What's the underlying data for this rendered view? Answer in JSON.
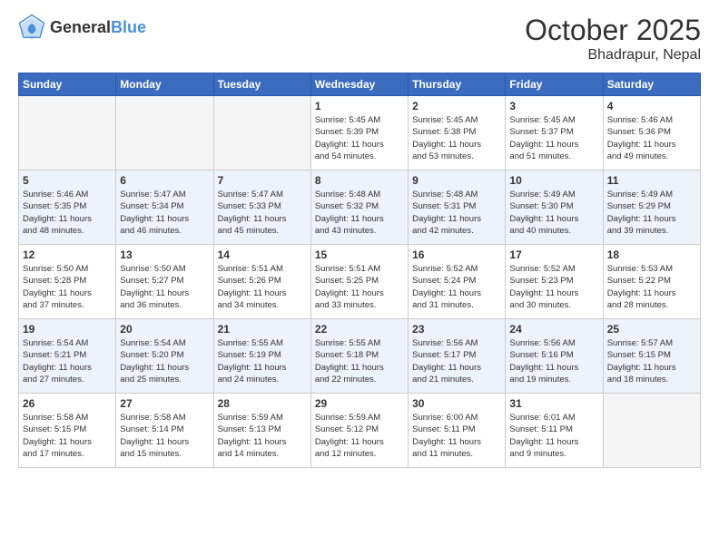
{
  "header": {
    "logo_general": "General",
    "logo_blue": "Blue",
    "month": "October 2025",
    "location": "Bhadrapur, Nepal"
  },
  "weekdays": [
    "Sunday",
    "Monday",
    "Tuesday",
    "Wednesday",
    "Thursday",
    "Friday",
    "Saturday"
  ],
  "weeks": [
    [
      {
        "day": "",
        "info": ""
      },
      {
        "day": "",
        "info": ""
      },
      {
        "day": "",
        "info": ""
      },
      {
        "day": "1",
        "info": "Sunrise: 5:45 AM\nSunset: 5:39 PM\nDaylight: 11 hours\nand 54 minutes."
      },
      {
        "day": "2",
        "info": "Sunrise: 5:45 AM\nSunset: 5:38 PM\nDaylight: 11 hours\nand 53 minutes."
      },
      {
        "day": "3",
        "info": "Sunrise: 5:45 AM\nSunset: 5:37 PM\nDaylight: 11 hours\nand 51 minutes."
      },
      {
        "day": "4",
        "info": "Sunrise: 5:46 AM\nSunset: 5:36 PM\nDaylight: 11 hours\nand 49 minutes."
      }
    ],
    [
      {
        "day": "5",
        "info": "Sunrise: 5:46 AM\nSunset: 5:35 PM\nDaylight: 11 hours\nand 48 minutes."
      },
      {
        "day": "6",
        "info": "Sunrise: 5:47 AM\nSunset: 5:34 PM\nDaylight: 11 hours\nand 46 minutes."
      },
      {
        "day": "7",
        "info": "Sunrise: 5:47 AM\nSunset: 5:33 PM\nDaylight: 11 hours\nand 45 minutes."
      },
      {
        "day": "8",
        "info": "Sunrise: 5:48 AM\nSunset: 5:32 PM\nDaylight: 11 hours\nand 43 minutes."
      },
      {
        "day": "9",
        "info": "Sunrise: 5:48 AM\nSunset: 5:31 PM\nDaylight: 11 hours\nand 42 minutes."
      },
      {
        "day": "10",
        "info": "Sunrise: 5:49 AM\nSunset: 5:30 PM\nDaylight: 11 hours\nand 40 minutes."
      },
      {
        "day": "11",
        "info": "Sunrise: 5:49 AM\nSunset: 5:29 PM\nDaylight: 11 hours\nand 39 minutes."
      }
    ],
    [
      {
        "day": "12",
        "info": "Sunrise: 5:50 AM\nSunset: 5:28 PM\nDaylight: 11 hours\nand 37 minutes."
      },
      {
        "day": "13",
        "info": "Sunrise: 5:50 AM\nSunset: 5:27 PM\nDaylight: 11 hours\nand 36 minutes."
      },
      {
        "day": "14",
        "info": "Sunrise: 5:51 AM\nSunset: 5:26 PM\nDaylight: 11 hours\nand 34 minutes."
      },
      {
        "day": "15",
        "info": "Sunrise: 5:51 AM\nSunset: 5:25 PM\nDaylight: 11 hours\nand 33 minutes."
      },
      {
        "day": "16",
        "info": "Sunrise: 5:52 AM\nSunset: 5:24 PM\nDaylight: 11 hours\nand 31 minutes."
      },
      {
        "day": "17",
        "info": "Sunrise: 5:52 AM\nSunset: 5:23 PM\nDaylight: 11 hours\nand 30 minutes."
      },
      {
        "day": "18",
        "info": "Sunrise: 5:53 AM\nSunset: 5:22 PM\nDaylight: 11 hours\nand 28 minutes."
      }
    ],
    [
      {
        "day": "19",
        "info": "Sunrise: 5:54 AM\nSunset: 5:21 PM\nDaylight: 11 hours\nand 27 minutes."
      },
      {
        "day": "20",
        "info": "Sunrise: 5:54 AM\nSunset: 5:20 PM\nDaylight: 11 hours\nand 25 minutes."
      },
      {
        "day": "21",
        "info": "Sunrise: 5:55 AM\nSunset: 5:19 PM\nDaylight: 11 hours\nand 24 minutes."
      },
      {
        "day": "22",
        "info": "Sunrise: 5:55 AM\nSunset: 5:18 PM\nDaylight: 11 hours\nand 22 minutes."
      },
      {
        "day": "23",
        "info": "Sunrise: 5:56 AM\nSunset: 5:17 PM\nDaylight: 11 hours\nand 21 minutes."
      },
      {
        "day": "24",
        "info": "Sunrise: 5:56 AM\nSunset: 5:16 PM\nDaylight: 11 hours\nand 19 minutes."
      },
      {
        "day": "25",
        "info": "Sunrise: 5:57 AM\nSunset: 5:15 PM\nDaylight: 11 hours\nand 18 minutes."
      }
    ],
    [
      {
        "day": "26",
        "info": "Sunrise: 5:58 AM\nSunset: 5:15 PM\nDaylight: 11 hours\nand 17 minutes."
      },
      {
        "day": "27",
        "info": "Sunrise: 5:58 AM\nSunset: 5:14 PM\nDaylight: 11 hours\nand 15 minutes."
      },
      {
        "day": "28",
        "info": "Sunrise: 5:59 AM\nSunset: 5:13 PM\nDaylight: 11 hours\nand 14 minutes."
      },
      {
        "day": "29",
        "info": "Sunrise: 5:59 AM\nSunset: 5:12 PM\nDaylight: 11 hours\nand 12 minutes."
      },
      {
        "day": "30",
        "info": "Sunrise: 6:00 AM\nSunset: 5:11 PM\nDaylight: 11 hours\nand 11 minutes."
      },
      {
        "day": "31",
        "info": "Sunrise: 6:01 AM\nSunset: 5:11 PM\nDaylight: 11 hours\nand 9 minutes."
      },
      {
        "day": "",
        "info": ""
      }
    ]
  ]
}
